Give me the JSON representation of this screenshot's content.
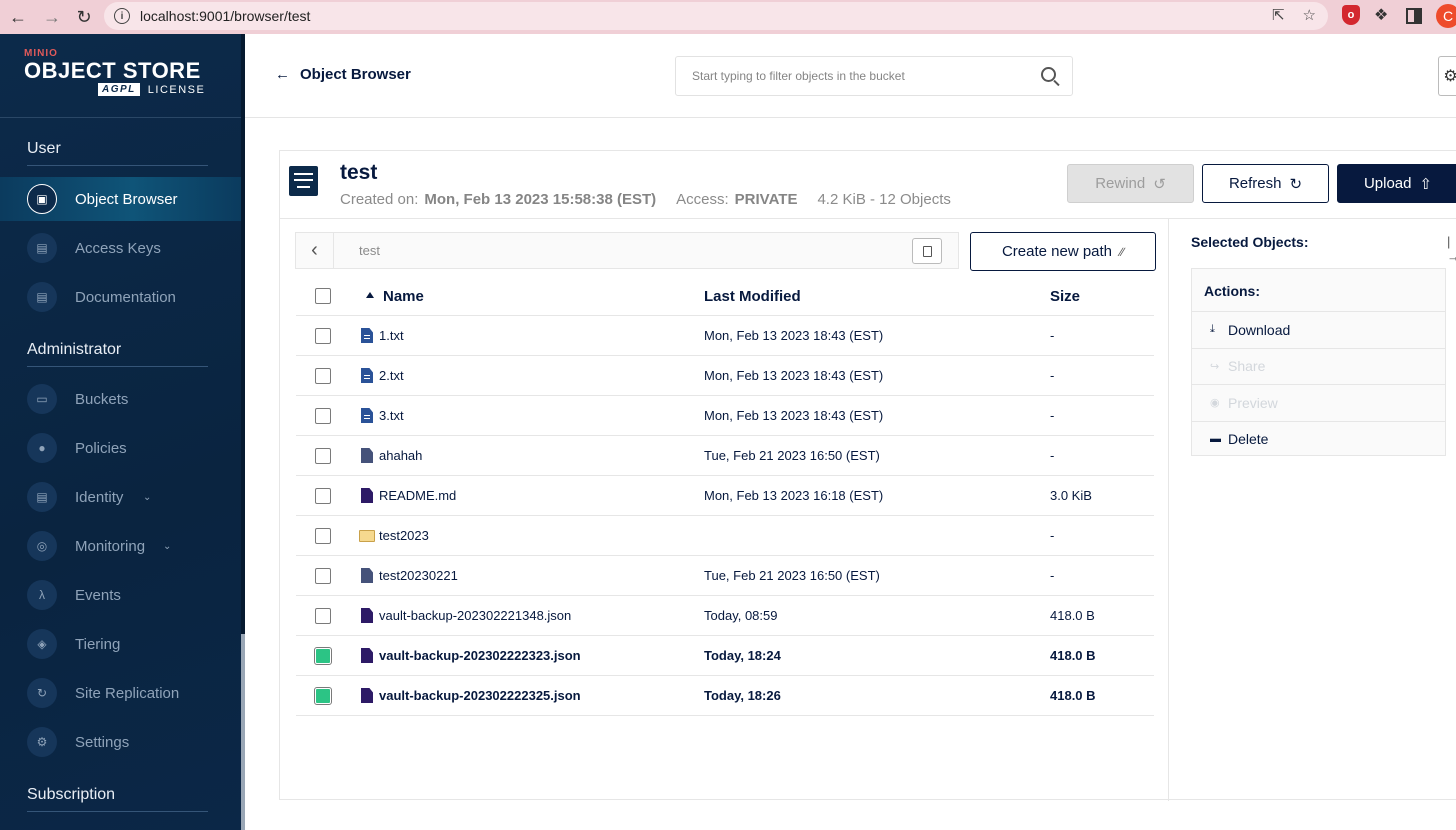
{
  "browser": {
    "url": "localhost:9001/browser/test",
    "info_glyph": "i",
    "red_ext_glyph": "ο",
    "avatar_letter": "C"
  },
  "sidebar": {
    "logo": {
      "brand": "MINIO",
      "product": "OBJECT STORE",
      "badge": "AGPL",
      "license": "LICENSE"
    },
    "sections": [
      {
        "title": "User",
        "items": [
          "Object Browser",
          "Access Keys",
          "Documentation"
        ]
      },
      {
        "title": "Administrator",
        "items": [
          "Buckets",
          "Policies",
          "Identity",
          "Monitoring",
          "Events",
          "Tiering",
          "Site Replication",
          "Settings"
        ]
      },
      {
        "title": "Subscription",
        "items": []
      }
    ],
    "active_item": "Object Browser",
    "icons": {
      "object-browser": "▣",
      "access-keys": "▤",
      "documentation": "▤",
      "buckets": "▭",
      "policies": "●",
      "identity": "▤",
      "monitoring": "◎",
      "events": "λ",
      "tiering": "◈",
      "site-replication": "↻",
      "settings": "⚙"
    }
  },
  "header": {
    "back_label": "Object Browser",
    "search_placeholder": "Start typing to filter objects in the bucket"
  },
  "bucket": {
    "name": "test",
    "created_label": "Created on:",
    "created_value": "Mon, Feb 13 2023 15:58:38 (EST)",
    "access_label": "Access:",
    "access_value": "PRIVATE",
    "summary": "4.2 KiB - 12 Objects",
    "buttons": {
      "rewind": "Rewind",
      "refresh": "Refresh",
      "upload": "Upload"
    }
  },
  "path": {
    "current": "test",
    "create_new_path": "Create new path"
  },
  "table": {
    "columns": {
      "name": "Name",
      "modified": "Last Modified",
      "size": "Size"
    },
    "rows": [
      {
        "name": "1.txt",
        "modified": "Mon, Feb 13 2023 18:43 (EST)",
        "size": "-",
        "type": "doc",
        "selected": false
      },
      {
        "name": "2.txt",
        "modified": "Mon, Feb 13 2023 18:43 (EST)",
        "size": "-",
        "type": "doc",
        "selected": false
      },
      {
        "name": "3.txt",
        "modified": "Mon, Feb 13 2023 18:43 (EST)",
        "size": "-",
        "type": "doc",
        "selected": false
      },
      {
        "name": "ahahah",
        "modified": "Tue, Feb 21 2023 16:50 (EST)",
        "size": "-",
        "type": "gen",
        "selected": false
      },
      {
        "name": "README.md",
        "modified": "Mon, Feb 13 2023 16:18 (EST)",
        "size": "3.0 KiB",
        "type": "json",
        "selected": false
      },
      {
        "name": "test2023",
        "modified": "",
        "size": "-",
        "type": "folder",
        "selected": false
      },
      {
        "name": "test20230221",
        "modified": "Tue, Feb 21 2023 16:50 (EST)",
        "size": "-",
        "type": "gen",
        "selected": false
      },
      {
        "name": "vault-backup-202302221348.json",
        "modified": "Today, 08:59",
        "size": "418.0 B",
        "type": "json",
        "selected": false
      },
      {
        "name": "vault-backup-202302222323.json",
        "modified": "Today, 18:24",
        "size": "418.0 B",
        "type": "json",
        "selected": true
      },
      {
        "name": "vault-backup-202302222325.json",
        "modified": "Today, 18:26",
        "size": "418.0 B",
        "type": "json",
        "selected": true
      }
    ]
  },
  "selection_panel": {
    "title": "Selected Objects:",
    "actions_title": "Actions:",
    "actions": [
      {
        "label": "Download",
        "enabled": true,
        "icon": "⤓"
      },
      {
        "label": "Share",
        "enabled": false,
        "icon": "↪"
      },
      {
        "label": "Preview",
        "enabled": false,
        "icon": "◉"
      },
      {
        "label": "Delete",
        "enabled": true,
        "icon": "▬"
      }
    ]
  },
  "colors": {
    "navy": "#07193e",
    "sidebar": "#0c2a4a",
    "checked": "#2cc485",
    "chrome": "#f0cfd6"
  }
}
